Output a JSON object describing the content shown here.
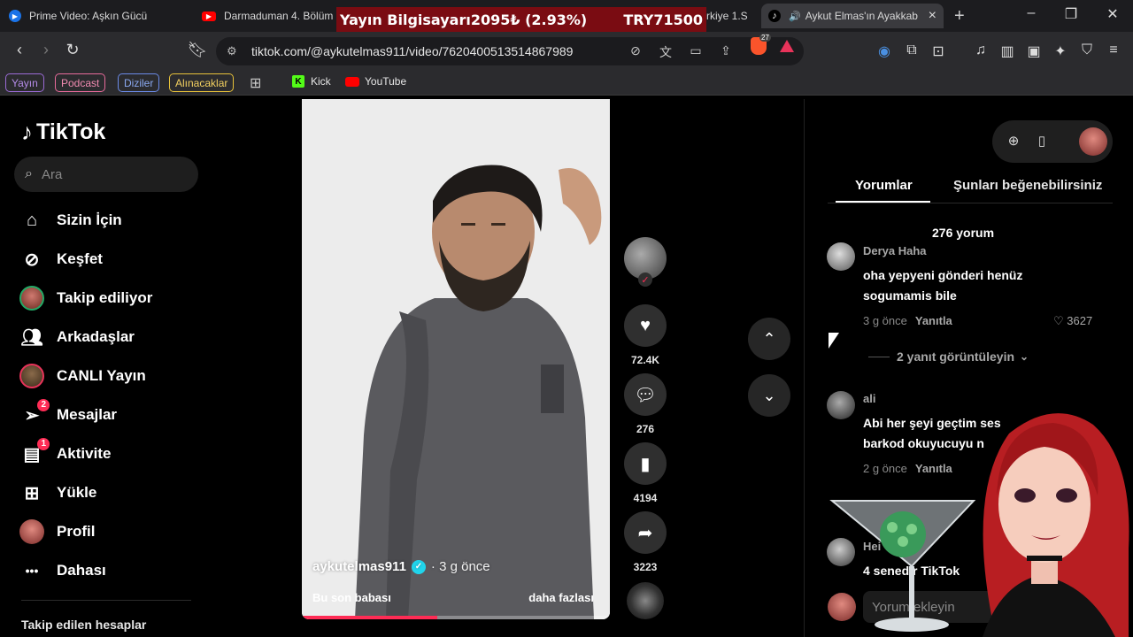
{
  "browser": {
    "tabs": [
      {
        "title": "Prime Video: Aşkın Gücü",
        "icon": "prime-video-icon"
      },
      {
        "title": "Darmaduman 4. Bölüm",
        "icon": "youtube-icon"
      },
      {
        "title": "rkiye 1.S",
        "icon": "tab-icon"
      },
      {
        "title": "Aykut Elmas'ın Ayakkab",
        "icon": "tiktok-icon",
        "active": true
      }
    ],
    "url": "tiktok.com/@aykutelmas911/video/7620400513514867989",
    "brave_count": "27",
    "bookmarks": {
      "chips": [
        {
          "label": "Yayın",
          "color": "#9b6bd6"
        },
        {
          "label": "Podcast",
          "color": "#e86b9b"
        },
        {
          "label": "Diziler",
          "color": "#6b8be8"
        },
        {
          "label": "Alınacaklar",
          "color": "#e8c23a"
        }
      ],
      "links": [
        {
          "label": "Kick",
          "icon": "kick-icon"
        },
        {
          "label": "YouTube",
          "icon": "youtube-icon"
        }
      ]
    }
  },
  "ticker": {
    "label": "Yayın Bilgisayarı",
    "price": "2095₺ (2.93%)",
    "total": "TRY71500"
  },
  "tiktok": {
    "logo": "TikTok",
    "search_placeholder": "Ara",
    "nav": [
      {
        "label": "Sizin İçin",
        "icon": "home-icon"
      },
      {
        "label": "Keşfet",
        "icon": "compass-icon"
      },
      {
        "label": "Takip ediliyor",
        "icon": "following-avatar-icon"
      },
      {
        "label": "Arkadaşlar",
        "icon": "friends-icon"
      },
      {
        "label": "CANLI Yayın",
        "icon": "live-avatar-icon"
      },
      {
        "label": "Mesajlar",
        "icon": "messages-icon",
        "badge": "2"
      },
      {
        "label": "Aktivite",
        "icon": "activity-icon",
        "badge": "1"
      },
      {
        "label": "Yükle",
        "icon": "upload-icon"
      },
      {
        "label": "Profil",
        "icon": "profile-avatar-icon"
      },
      {
        "label": "Dahası",
        "icon": "more-dots-icon"
      }
    ],
    "followed_accounts_title": "Takip edilen hesaplar",
    "video": {
      "author": "aykutelmas911",
      "time": "· 3 g önce",
      "caption": "Bu son babası",
      "more": "daha fazlası",
      "progress": 0.44
    },
    "actions": {
      "likes": "72.4K",
      "comments": "276",
      "saves": "4194",
      "shares": "3223"
    },
    "panel": {
      "tab_comments": "Yorumlar",
      "tab_suggest": "Şunları beğenebilirsiniz",
      "comment_count": "276 yorum",
      "comments": [
        {
          "user": "Derya Haha",
          "text": "oha yepyeni gönderi henüz sogumamis bile",
          "time": "3 g önce",
          "reply": "Yanıtla",
          "likes": "3627",
          "view_replies": "2 yanıt görüntüleyin"
        },
        {
          "user": "ali",
          "text": "Abi her şeyi geçtim ses barkod okuyucuyu n",
          "time": "2 g önce",
          "reply": "Yanıtla"
        },
        {
          "user": "Hei",
          "text": "4 senedir TikTok"
        }
      ],
      "input_placeholder": "Yorum ekleyin"
    }
  }
}
